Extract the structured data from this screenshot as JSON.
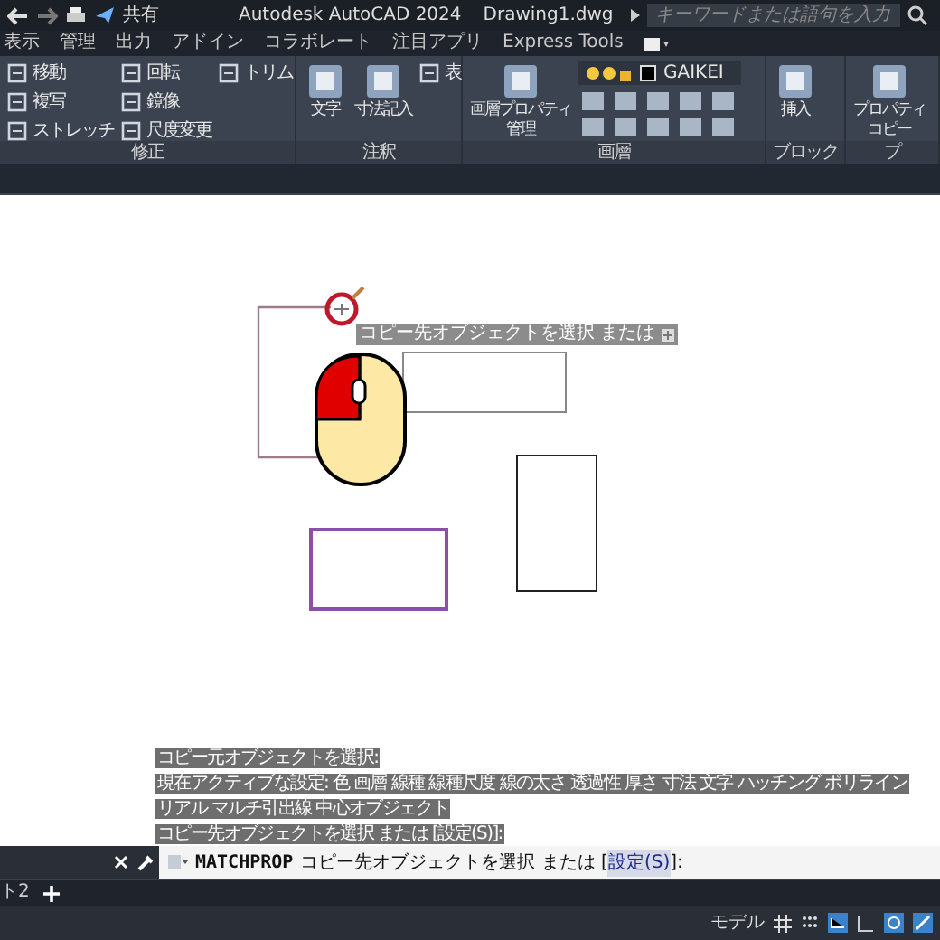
{
  "title_bar": {
    "share": "共有",
    "title": "Autodesk AutoCAD 2024",
    "file": "Drawing1.dwg",
    "search": {
      "placeholder": "キーワードまたは語句を入力"
    }
  },
  "menu_tabs": [
    {
      "label": "表示",
      "selected": false
    },
    {
      "label": "管理",
      "selected": false
    },
    {
      "label": "出力",
      "selected": false
    },
    {
      "label": "アドイン",
      "selected": false
    },
    {
      "label": "コラボレート",
      "selected": false
    },
    {
      "label": "注目アプリ",
      "selected": false
    },
    {
      "label": "Express Tools",
      "selected": false
    }
  ],
  "ribbon": {
    "panels": [
      {
        "title": "修正",
        "tools": [
          {
            "label": "移動",
            "kind": "small"
          },
          {
            "label": "複写",
            "kind": "small"
          },
          {
            "label": "ストレッチ",
            "kind": "small"
          },
          {
            "label": "回転",
            "kind": "small"
          },
          {
            "label": "鏡像",
            "kind": "small"
          },
          {
            "label": "尺度変更",
            "kind": "small"
          },
          {
            "label": "トリム",
            "kind": "small"
          }
        ]
      },
      {
        "title": "注釈",
        "tools": [
          {
            "lines": [
              "文字"
            ],
            "kind": "big"
          },
          {
            "lines": [
              "寸法記入"
            ],
            "kind": "big"
          },
          {
            "label": "表",
            "kind": "small"
          }
        ]
      },
      {
        "title": "画層",
        "tools": [
          {
            "lines": [
              "画層プロパティ",
              "管理"
            ],
            "kind": "big"
          },
          {
            "label": "GAIKEI",
            "kind": "layer"
          }
        ]
      },
      {
        "title": "ブロック",
        "tools": [
          {
            "lines": [
              "挿入"
            ],
            "kind": "big"
          }
        ]
      },
      {
        "title": "プ",
        "tools": [
          {
            "lines": [
              "プロパティ",
              "コピー"
            ],
            "kind": "big"
          }
        ]
      }
    ]
  },
  "tooltip": "コピー先オブジェクトを選択 または",
  "command_history": [
    "コピー元オブジェクトを選択:",
    "現在アクティブな設定:  色 画層 線種 線種尺度 線の太さ 透過性 厚さ 寸法 文字 ハッチング ポリライン",
    "リアル マルチ引出線 中心オブジェクト",
    "コピー先オブジェクトを選択 または [設定(S)]:"
  ],
  "command_line": {
    "command": "MATCHPROP",
    "prompt": "コピー先オブジェクトを選択 または [",
    "option": "設定(S)",
    "suffix": "]:"
  },
  "layout_tabs": [
    "ト2"
  ],
  "status_bar": {
    "mode": "モデル"
  }
}
